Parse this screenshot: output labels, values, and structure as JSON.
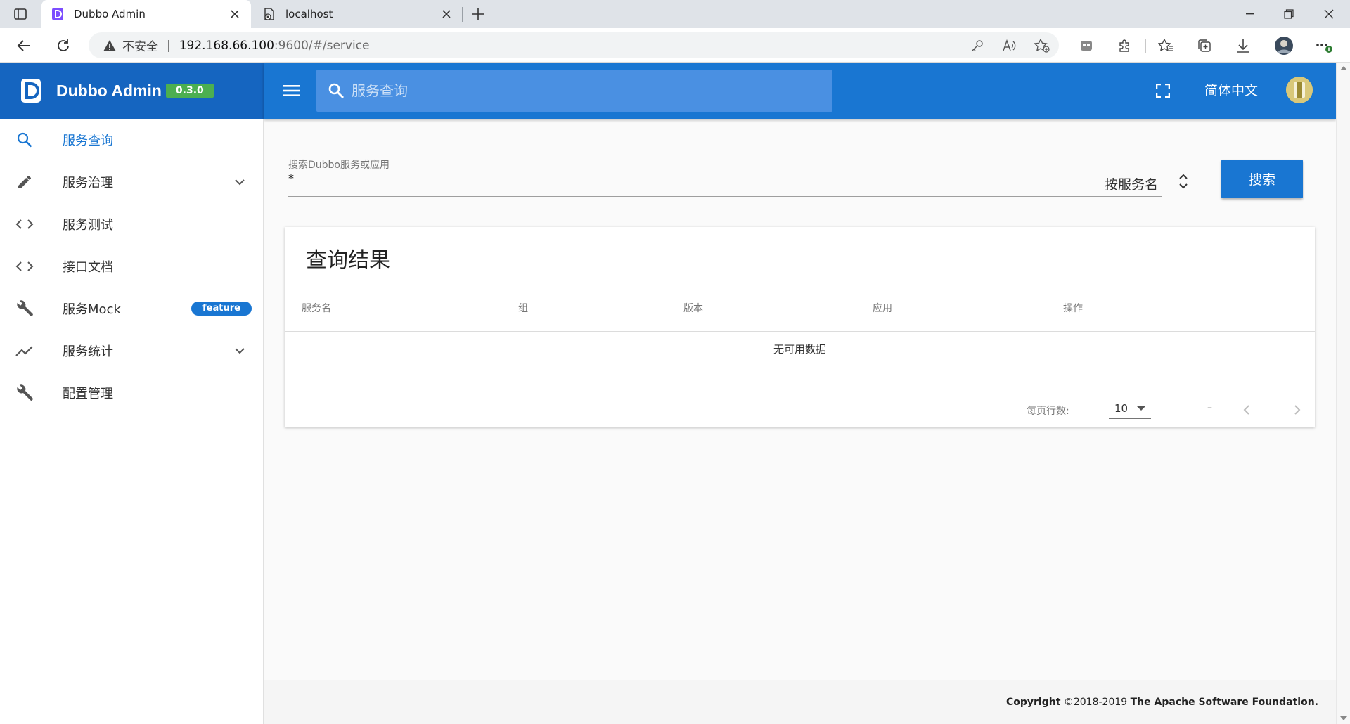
{
  "browser": {
    "tabs": [
      {
        "title": "Dubbo Admin",
        "active": true
      },
      {
        "title": "localhost",
        "active": false
      }
    ],
    "omnibox": {
      "security_text": "不安全",
      "url_host": "192.168.66.100",
      "url_rest": ":9600/#/service"
    }
  },
  "brand": {
    "name": "Dubbo Admin",
    "version": "0.3.0",
    "primary_color": "#1565c0",
    "version_color": "#4caf50"
  },
  "header": {
    "search_placeholder": "服务查询",
    "language": "简体中文",
    "color": "#1976d2"
  },
  "sidebar": {
    "items": [
      {
        "label": "服务查询",
        "icon": "search-icon",
        "active": true
      },
      {
        "label": "服务治理",
        "icon": "pencil-icon",
        "expandable": true
      },
      {
        "label": "服务测试",
        "icon": "code-icon"
      },
      {
        "label": "接口文档",
        "icon": "code-icon"
      },
      {
        "label": "服务Mock",
        "icon": "wrench-icon",
        "badge": "feature"
      },
      {
        "label": "服务统计",
        "icon": "trending-icon",
        "expandable": true
      },
      {
        "label": "配置管理",
        "icon": "wrench-icon"
      }
    ]
  },
  "search": {
    "label": "搜索Dubbo服务或应用",
    "value": "*",
    "type": "按服务名",
    "button": "搜索"
  },
  "results": {
    "title": "查询结果",
    "columns": [
      "服务名",
      "组",
      "版本",
      "应用",
      "操作"
    ],
    "rows": [],
    "empty_text": "无可用数据",
    "rows_per_page_label": "每页行数:",
    "rows_per_page": "10",
    "range": "–"
  },
  "footer": {
    "copyright_pre": "Copyright",
    "copyright_mid": " ©2018-2019 ",
    "copyright_org": "The Apache Software Foundation."
  }
}
